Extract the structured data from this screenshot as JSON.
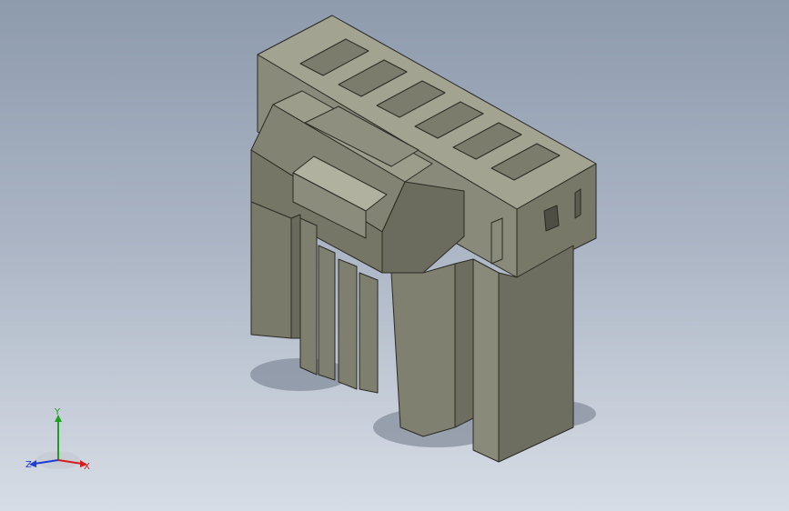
{
  "viewport": {
    "background_top": "#8e9bad",
    "background_bottom": "#d7dde6"
  },
  "model": {
    "name": "",
    "body_color": "#8a8a7a",
    "face_light": "#9c9c8c",
    "face_dark": "#6f6f62",
    "edge_color": "#2a2a24",
    "pin_cavity_count": 6
  },
  "triad": {
    "x_label": "X",
    "y_label": "Y",
    "z_label": "Z",
    "x_color": "#d21e1e",
    "y_color": "#1ea01e",
    "z_color": "#1e3cd2"
  }
}
